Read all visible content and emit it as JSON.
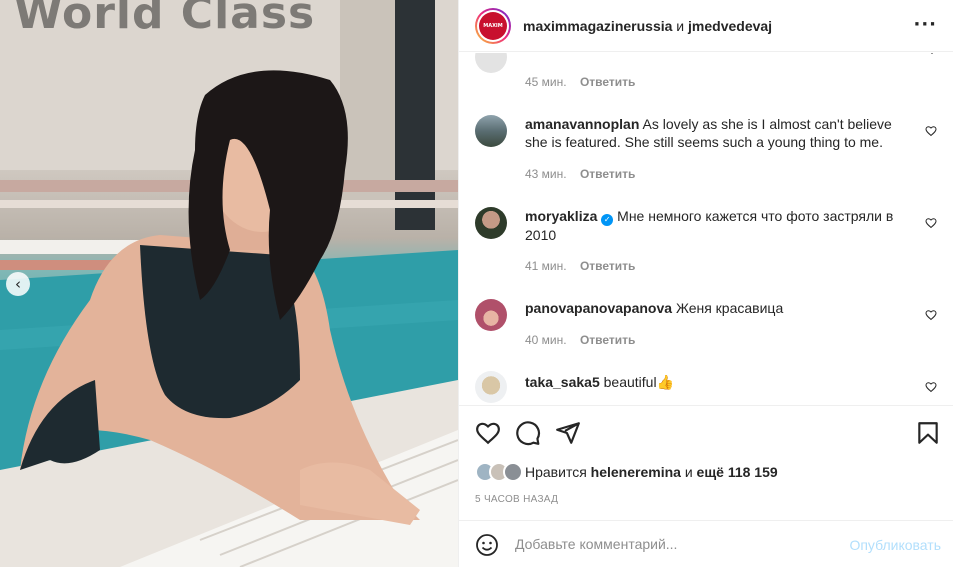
{
  "photo": {
    "sign_text": "World Class",
    "description_icon": "woman-in-pool-photo",
    "carousel_prev_glyph": "‹"
  },
  "header": {
    "avatar_text": "MAXIM",
    "username_primary": "maximmagazinerussia",
    "conjunction": "и",
    "username_secondary": "jmedvedevaj",
    "more_icon": "more-horizontal-icon"
  },
  "comments": [
    {
      "username": "",
      "text": "",
      "time": "45 мин.",
      "reply": "Ответить",
      "avatar_color": "#e3e3e3",
      "verified": false
    },
    {
      "username": "amanavannoplan",
      "text": "As lovely as she is I almost can't believe she is featured. She still seems such a young thing to me.",
      "time": "43 мин.",
      "reply": "Ответить",
      "avatar_color": "#5a6d72",
      "verified": false
    },
    {
      "username": "moryakliza",
      "text": "Мне немного кажется что фото застряли в 2010",
      "time": "41 мин.",
      "reply": "Ответить",
      "avatar_color": "#2e3b2a",
      "verified": true
    },
    {
      "username": "panovapanovapanova",
      "text": "Женя красавица",
      "time": "40 мин.",
      "reply": "Ответить",
      "avatar_color": "#b0506a",
      "verified": false
    },
    {
      "username": "taka_saka5",
      "text": "beautiful👍",
      "time": "",
      "reply": "",
      "avatar_color": "#d9c7a6",
      "verified": false
    }
  ],
  "actions": {
    "like_icon": "heart-icon",
    "comment_icon": "comment-icon",
    "share_icon": "send-icon",
    "save_icon": "bookmark-icon"
  },
  "likes": {
    "prefix": "Нравится",
    "user": "heleneremina",
    "middle": "и",
    "others": "ещё 118 159"
  },
  "time_ago": "5 ЧАСОВ НАЗАД",
  "add_comment": {
    "placeholder": "Добавьте комментарий...",
    "post_label": "Опубликовать",
    "emoji_icon": "emoji-icon"
  },
  "colors": {
    "link_blue": "#0095f6",
    "post_disabled": "#b2dffc",
    "muted": "#8e8e8e",
    "brand_red": "#c8102e"
  }
}
